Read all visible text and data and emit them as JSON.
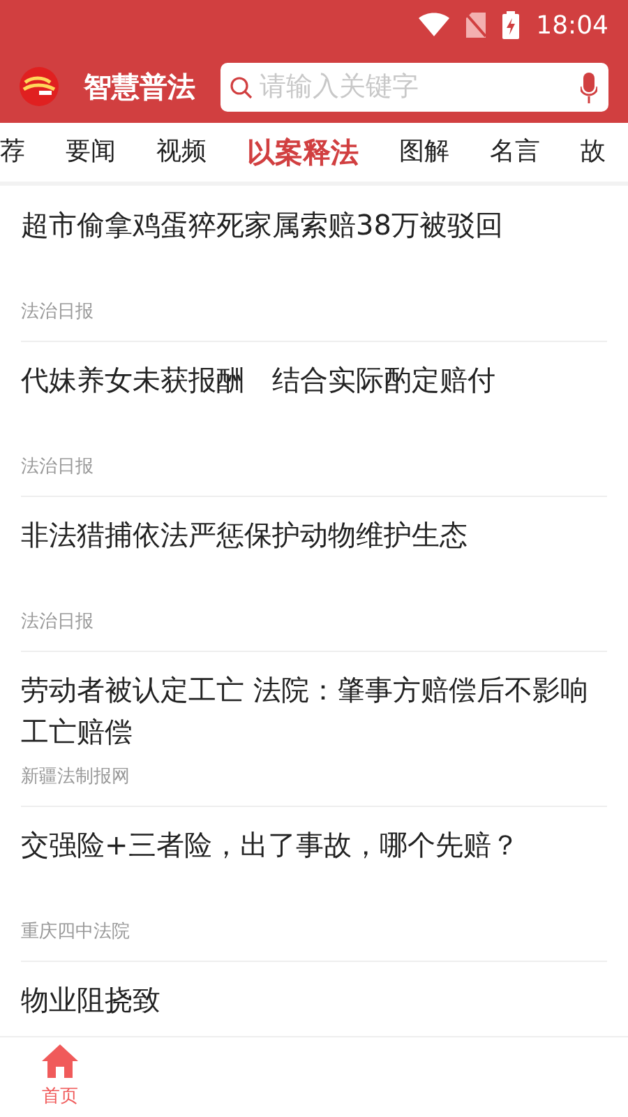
{
  "status_bar": {
    "time": "18:04"
  },
  "header": {
    "title": "智慧普法",
    "search": {
      "placeholder": "请输入关键字"
    }
  },
  "tabs": [
    {
      "label": "荐",
      "selected": false
    },
    {
      "label": "要闻",
      "selected": false
    },
    {
      "label": "视频",
      "selected": false
    },
    {
      "label": "以案释法",
      "selected": true
    },
    {
      "label": "图解",
      "selected": false
    },
    {
      "label": "名言",
      "selected": false
    },
    {
      "label": "故",
      "selected": false
    }
  ],
  "articles": [
    {
      "title": "超市偷拿鸡蛋猝死家属索赔38万被驳回",
      "source": "法治日报"
    },
    {
      "title": "代妹养女未获报酬　结合实际酌定赔付",
      "source": "法治日报"
    },
    {
      "title": "非法猎捕依法严惩保护动物维护生态",
      "source": "法治日报"
    },
    {
      "title": "劳动者被认定工亡 法院：肇事方赔偿后不影响工亡赔偿",
      "source": "新疆法制报网"
    },
    {
      "title": "交强险+三者险，出了事故，哪个先赔？",
      "source": "重庆四中法院"
    },
    {
      "title": "物业阻挠致"
    }
  ],
  "bottom_nav": [
    {
      "label": "首页",
      "selected": true
    }
  ]
}
